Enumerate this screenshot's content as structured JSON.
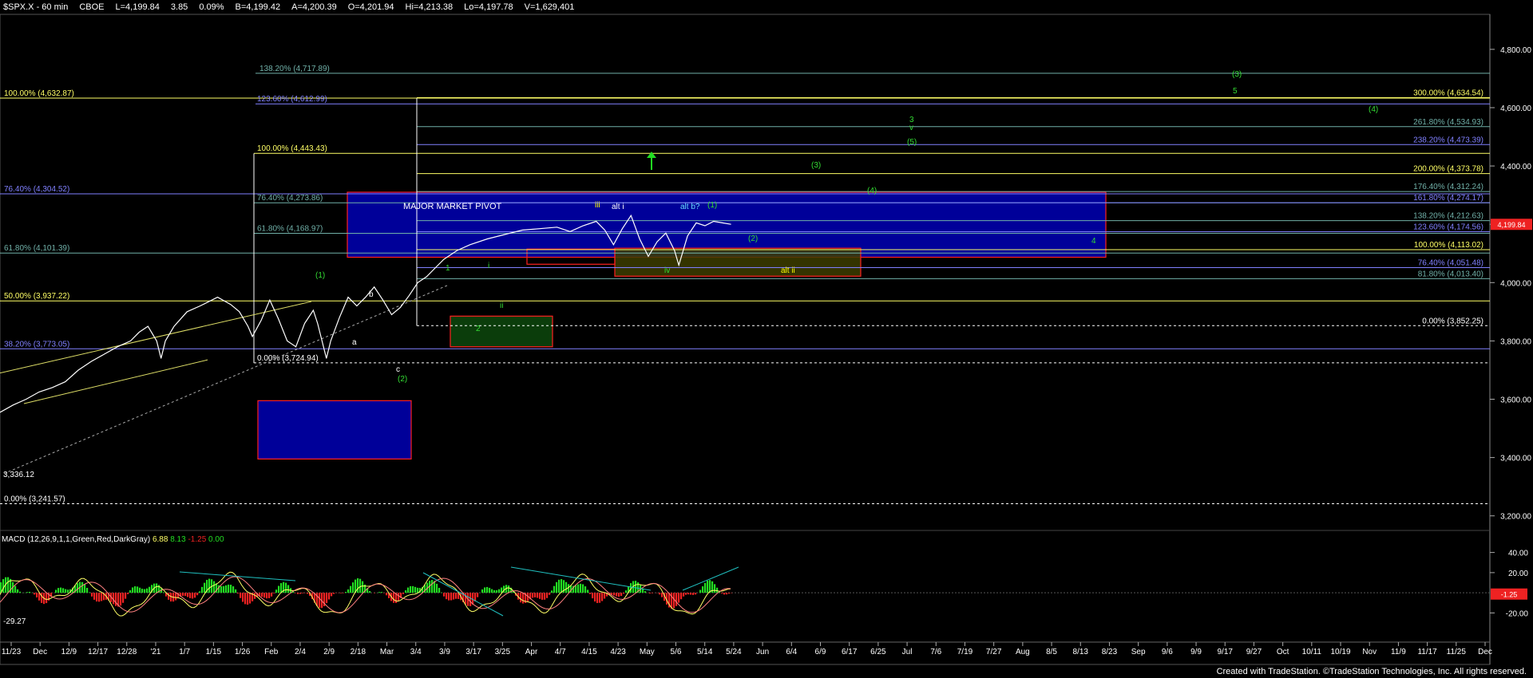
{
  "header": {
    "symbol": "$SPX.X - 60 min",
    "exchange": "CBOE",
    "last": "L=4,199.84",
    "change": "3.85",
    "pct": "0.09%",
    "bid": "B=4,199.42",
    "ask": "A=4,200.39",
    "open": "O=4,201.94",
    "high": "Hi=4,213.38",
    "low": "Lo=4,197.78",
    "volume": "V=1,629,401"
  },
  "footer": "Created with TradeStation. ©TradeStation Technologies, Inc. All rights reserved.",
  "macd": {
    "label": "MACD (12,26,9,1,1,Green,Red,DarkGray)",
    "v1": "6.88",
    "v2": "8.13",
    "v3": "-1.25",
    "v4": "0.00",
    "ticks": [
      "40.00",
      "20.00",
      "-20.00"
    ],
    "left_value": "-29.27",
    "current": "-1.25"
  },
  "colors": {
    "price": "#ffffff",
    "fib_yellow": "#ffff66",
    "fib_blue": "#8080ff",
    "fib_teal": "#70b0a8",
    "wave_green": "#33dd33",
    "wave_yellow": "#ffff00",
    "pivot_box": "#000099",
    "pivot_border": "#ff2020",
    "green_box": "#0b3d0b",
    "olive_box": "#3d3d00",
    "trendline": "#20c0c0",
    "macd_up": "#22dd22",
    "macd_down": "#ee2222"
  },
  "chart_data": {
    "type": "line",
    "title": "$SPX.X - 60 min",
    "price_axis": [
      "4,800.00",
      "4,600.00",
      "4,400.00",
      "4,200.00",
      "4,000.00",
      "3,800.00",
      "3,600.00",
      "3,400.00",
      "3,200.00"
    ],
    "current_price_tag": "4,199.84",
    "x_ticks": [
      "11/23",
      "Dec",
      "12/9",
      "12/17",
      "12/28",
      "'21",
      "1/7",
      "1/15",
      "1/26",
      "Feb",
      "2/4",
      "2/9",
      "2/18",
      "Mar",
      "3/4",
      "3/9",
      "3/17",
      "3/25",
      "Apr",
      "4/7",
      "4/15",
      "4/23",
      "May",
      "5/6",
      "5/14",
      "5/24",
      "Jun",
      "6/4",
      "6/9",
      "6/17",
      "6/25",
      "Jul",
      "7/6",
      "7/19",
      "7/27",
      "Aug",
      "8/5",
      "8/13",
      "8/23",
      "Sep",
      "9/6",
      "9/9",
      "9/17",
      "9/27",
      "Oct",
      "10/11",
      "10/19",
      "Nov",
      "11/9",
      "11/17",
      "11/25",
      "Dec"
    ],
    "price_path": [
      [
        0,
        3555
      ],
      [
        0.03,
        3580
      ],
      [
        0.06,
        3600
      ],
      [
        0.09,
        3625
      ],
      [
        0.12,
        3640
      ],
      [
        0.15,
        3660
      ],
      [
        0.18,
        3700
      ],
      [
        0.21,
        3730
      ],
      [
        0.24,
        3755
      ],
      [
        0.27,
        3780
      ],
      [
        0.3,
        3800
      ],
      [
        0.32,
        3830
      ],
      [
        0.34,
        3850
      ],
      [
        0.36,
        3800
      ],
      [
        0.37,
        3740
      ],
      [
        0.38,
        3800
      ],
      [
        0.4,
        3850
      ],
      [
        0.43,
        3900
      ],
      [
        0.46,
        3920
      ],
      [
        0.48,
        3935
      ],
      [
        0.5,
        3950
      ],
      [
        0.53,
        3925
      ],
      [
        0.55,
        3900
      ],
      [
        0.57,
        3850
      ],
      [
        0.58,
        3815
      ],
      [
        0.6,
        3870
      ],
      [
        0.62,
        3940
      ],
      [
        0.64,
        3875
      ],
      [
        0.66,
        3800
      ],
      [
        0.68,
        3780
      ],
      [
        0.7,
        3860
      ],
      [
        0.72,
        3905
      ],
      [
        0.73,
        3860
      ],
      [
        0.74,
        3800
      ],
      [
        0.75,
        3740
      ],
      [
        0.76,
        3800
      ],
      [
        0.78,
        3880
      ],
      [
        0.8,
        3950
      ],
      [
        0.82,
        3920
      ],
      [
        0.84,
        3950
      ],
      [
        0.86,
        3985
      ],
      [
        0.88,
        3940
      ],
      [
        0.9,
        3890
      ],
      [
        0.92,
        3915
      ],
      [
        0.94,
        3955
      ],
      [
        0.96,
        4000
      ],
      [
        0.98,
        4020
      ],
      [
        1.0,
        4050
      ],
      [
        1.02,
        4080
      ],
      [
        1.05,
        4110
      ],
      [
        1.08,
        4130
      ],
      [
        1.12,
        4150
      ],
      [
        1.16,
        4165
      ],
      [
        1.2,
        4180
      ],
      [
        1.24,
        4185
      ],
      [
        1.28,
        4190
      ],
      [
        1.31,
        4175
      ],
      [
        1.34,
        4195
      ],
      [
        1.37,
        4210
      ],
      [
        1.39,
        4180
      ],
      [
        1.41,
        4130
      ],
      [
        1.43,
        4185
      ],
      [
        1.45,
        4230
      ],
      [
        1.47,
        4150
      ],
      [
        1.49,
        4090
      ],
      [
        1.51,
        4140
      ],
      [
        1.53,
        4170
      ],
      [
        1.55,
        4110
      ],
      [
        1.56,
        4060
      ],
      [
        1.58,
        4160
      ],
      [
        1.6,
        4205
      ],
      [
        1.62,
        4195
      ],
      [
        1.64,
        4210
      ],
      [
        1.66,
        4205
      ],
      [
        1.68,
        4200
      ]
    ],
    "fib_levels": [
      {
        "label": "138.20% (4,717.89)",
        "value": 4717.89,
        "color": "teal"
      },
      {
        "label": "100.00% (4,632.87)",
        "value": 4632.87,
        "color": "yellow"
      },
      {
        "label": "123.60% (4,612.99)",
        "value": 4612.99,
        "color": "blue"
      },
      {
        "label": "100.00% (4,443.43)",
        "value": 4443.43,
        "color": "yellow"
      },
      {
        "label": "76.40% (4,304.52)",
        "value": 4304.52,
        "color": "blue"
      },
      {
        "label": "76.40% (4,273.86)",
        "value": 4273.86,
        "color": "teal"
      },
      {
        "label": "61.80% (4,168.97)",
        "value": 4168.97,
        "color": "teal"
      },
      {
        "label": "61.80% (4,101.39)",
        "value": 4101.39,
        "color": "teal"
      },
      {
        "label": "50.00% (3,937.22)",
        "value": 3937.22,
        "color": "yellow"
      },
      {
        "label": "38.20% (3,773.05)",
        "value": 3773.05,
        "color": "blue"
      },
      {
        "label": "0.00% (3,724.94)",
        "value": 3724.94,
        "color": "white"
      },
      {
        "label": "0.00% (3,241.57)",
        "value": 3241.57,
        "color": "white"
      },
      {
        "label": "300.00% (4,634.54)",
        "value": 4634.54,
        "color": "yellow"
      },
      {
        "label": "261.80% (4,534.93)",
        "value": 4534.93,
        "color": "teal"
      },
      {
        "label": "238.20% (4,473.39)",
        "value": 4473.39,
        "color": "blue"
      },
      {
        "label": "200.00% (4,373.78)",
        "value": 4373.78,
        "color": "yellow"
      },
      {
        "label": "176.40% (4,312.24)",
        "value": 4312.24,
        "color": "teal"
      },
      {
        "label": "161.80% (4,274.17)",
        "value": 4274.17,
        "color": "blue"
      },
      {
        "label": "138.20% (4,212.63)",
        "value": 4212.63,
        "color": "teal"
      },
      {
        "label": "123.60% (4,174.56)",
        "value": 4174.56,
        "color": "blue"
      },
      {
        "label": "100.00% (4,113.02)",
        "value": 4113.02,
        "color": "yellow"
      },
      {
        "label": "76.40% (4,051.48)",
        "value": 4051.48,
        "color": "blue"
      },
      {
        "label": "81.80% (4,013.40)",
        "value": 4013.4,
        "color": "teal"
      },
      {
        "label": "0.00% (3,852.25)",
        "value": 3852.25,
        "color": "white"
      }
    ],
    "annotations": [
      "MAJOR MARKET PIVOT",
      "(1)",
      "b",
      "a",
      "c",
      "(2)",
      "1",
      "i",
      "ii",
      "2",
      "iii",
      "alt i",
      "alt b?",
      "(1)",
      "iv",
      "(2)",
      "alt ii",
      "(3)",
      "(4)",
      "3",
      "v",
      "(5)",
      "4",
      "(3)",
      "5",
      "(4)",
      "3,336.12"
    ]
  }
}
